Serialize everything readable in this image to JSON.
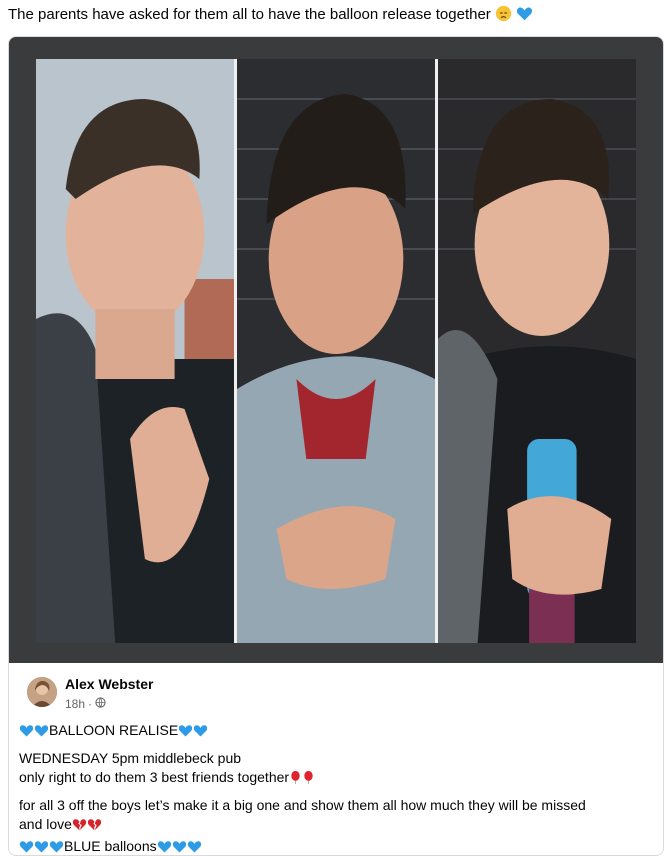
{
  "post": {
    "text": "The parents have asked for them all to have the balloon release together",
    "emojis": [
      "disappointed-face-emoji",
      "blue-heart-emoji"
    ]
  },
  "shared_post": {
    "author": "Alex Webster",
    "time": "18h",
    "dot": "·",
    "privacy_icon": "globe-icon",
    "lines": {
      "heading": "BALLOON REALISE",
      "l1": "WEDNESDAY 5pm middlebeck pub",
      "l2": "only right to do them 3 best friends together",
      "l3": "for all 3 off the boys let’s make it a big one and show them all how much they will be missed",
      "l4": "and love",
      "l5": "BLUE balloons"
    }
  },
  "colors": {
    "blue_heart": "#2e9be6",
    "red_balloon": "#e0242e",
    "broken_heart": "#d8222a",
    "media_bg": "#3a3b3c"
  }
}
